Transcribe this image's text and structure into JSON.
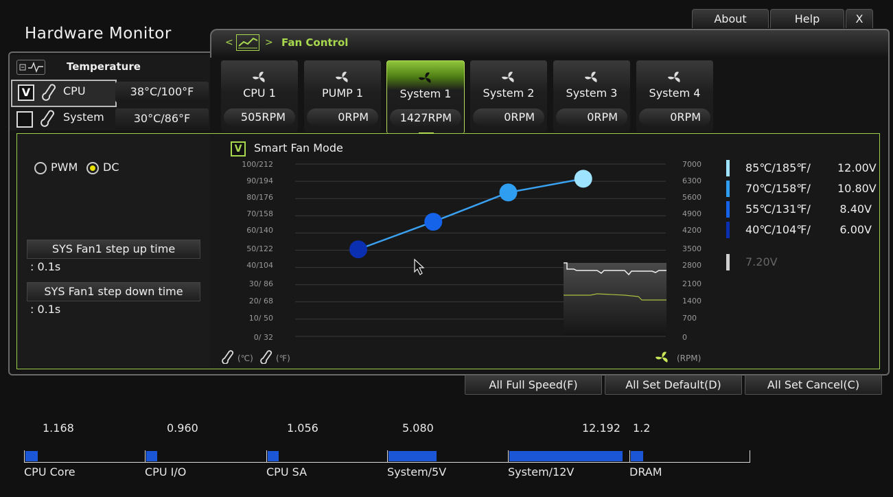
{
  "window": {
    "title": "Hardware Monitor",
    "about_label": "About",
    "help_label": "Help",
    "close_label": "X"
  },
  "breadcrumb": {
    "prev": "<",
    "sep": ">",
    "section": "Fan Control"
  },
  "temperature": {
    "header": "Temperature",
    "sensors": [
      {
        "name": "CPU",
        "checked": true,
        "check_mark": "V",
        "value": "38°C/100°F"
      },
      {
        "name": "System",
        "checked": false,
        "check_mark": "",
        "value": "30°C/86°F"
      }
    ]
  },
  "fans": [
    {
      "name": "CPU 1",
      "rpm": "505RPM",
      "selected": false
    },
    {
      "name": "PUMP 1",
      "rpm": "0RPM",
      "selected": false
    },
    {
      "name": "System 1",
      "rpm": "1427RPM",
      "selected": true
    },
    {
      "name": "System 2",
      "rpm": "0RPM",
      "selected": false
    },
    {
      "name": "System 3",
      "rpm": "0RPM",
      "selected": false
    },
    {
      "name": "System 4",
      "rpm": "0RPM",
      "selected": false
    }
  ],
  "mode": {
    "pwm_label": "PWM",
    "dc_label": "DC",
    "selected": "DC"
  },
  "steps": {
    "up_label": "SYS Fan1 step up time",
    "up_value": ": 0.1s",
    "down_label": "SYS Fan1 step down time",
    "down_value": ": 0.1s"
  },
  "smart_fan": {
    "label": "Smart Fan Mode",
    "checked": true,
    "check_mark": "V"
  },
  "chart": {
    "left_ticks": [
      "100/212",
      "90/194",
      "80/176",
      "70/158",
      "60/140",
      "50/122",
      "40/104",
      "30/ 86",
      "20/ 68",
      "10/ 50",
      "0/ 32"
    ],
    "right_ticks": [
      "7000",
      "6300",
      "5600",
      "4900",
      "4200",
      "3500",
      "2800",
      "2100",
      "1400",
      "700",
      "0"
    ],
    "unit_c": "(℃)",
    "unit_f": "(℉)",
    "unit_rpm": "(RPM)"
  },
  "chart_data": {
    "type": "line",
    "x": [
      40,
      55,
      70,
      85
    ],
    "xlabel": "℃",
    "ylim_left": [
      0,
      100
    ],
    "ylim_right": [
      0,
      7000
    ],
    "series": [
      {
        "temp_c": [
          50.5,
          66.5,
          83.5,
          91.5
        ],
        "colors": [
          "#0a2fb0",
          "#1563e8",
          "#2f9ef0",
          "#9ee3ff"
        ]
      }
    ],
    "grid": true
  },
  "legend": [
    {
      "temp": "85℃/185℉/",
      "volt": "12.00V",
      "color": "#9ee3ff"
    },
    {
      "temp": "70℃/158℉/",
      "volt": "10.80V",
      "color": "#2f9ef0"
    },
    {
      "temp": "55℃/131℉/",
      "volt": "8.40V",
      "color": "#1563e8"
    },
    {
      "temp": "40℃/104℉/",
      "volt": "6.00V",
      "color": "#0a2fb0"
    },
    {
      "temp": "",
      "volt": "7.20V",
      "color": "#cfcfcf"
    }
  ],
  "actions": {
    "full_speed": "All Full Speed(F)",
    "set_default": "All Set Default(D)",
    "set_cancel": "All Set Cancel(C)"
  },
  "voltages": [
    {
      "name": "CPU Core",
      "value": "1.168",
      "fill": 0.1
    },
    {
      "name": "CPU I/O",
      "value": "0.960",
      "fill": 0.08
    },
    {
      "name": "CPU SA",
      "value": "1.056",
      "fill": 0.09
    },
    {
      "name": "System/5V",
      "value": "5.080",
      "fill": 0.4
    },
    {
      "name": "System/12V",
      "value": "12.192",
      "fill": 0.94
    },
    {
      "name": "DRAM",
      "value": "1.2",
      "fill": 0.1
    }
  ],
  "colors": {
    "accent": "#9ccf4a",
    "bar": "#1a56d6"
  }
}
